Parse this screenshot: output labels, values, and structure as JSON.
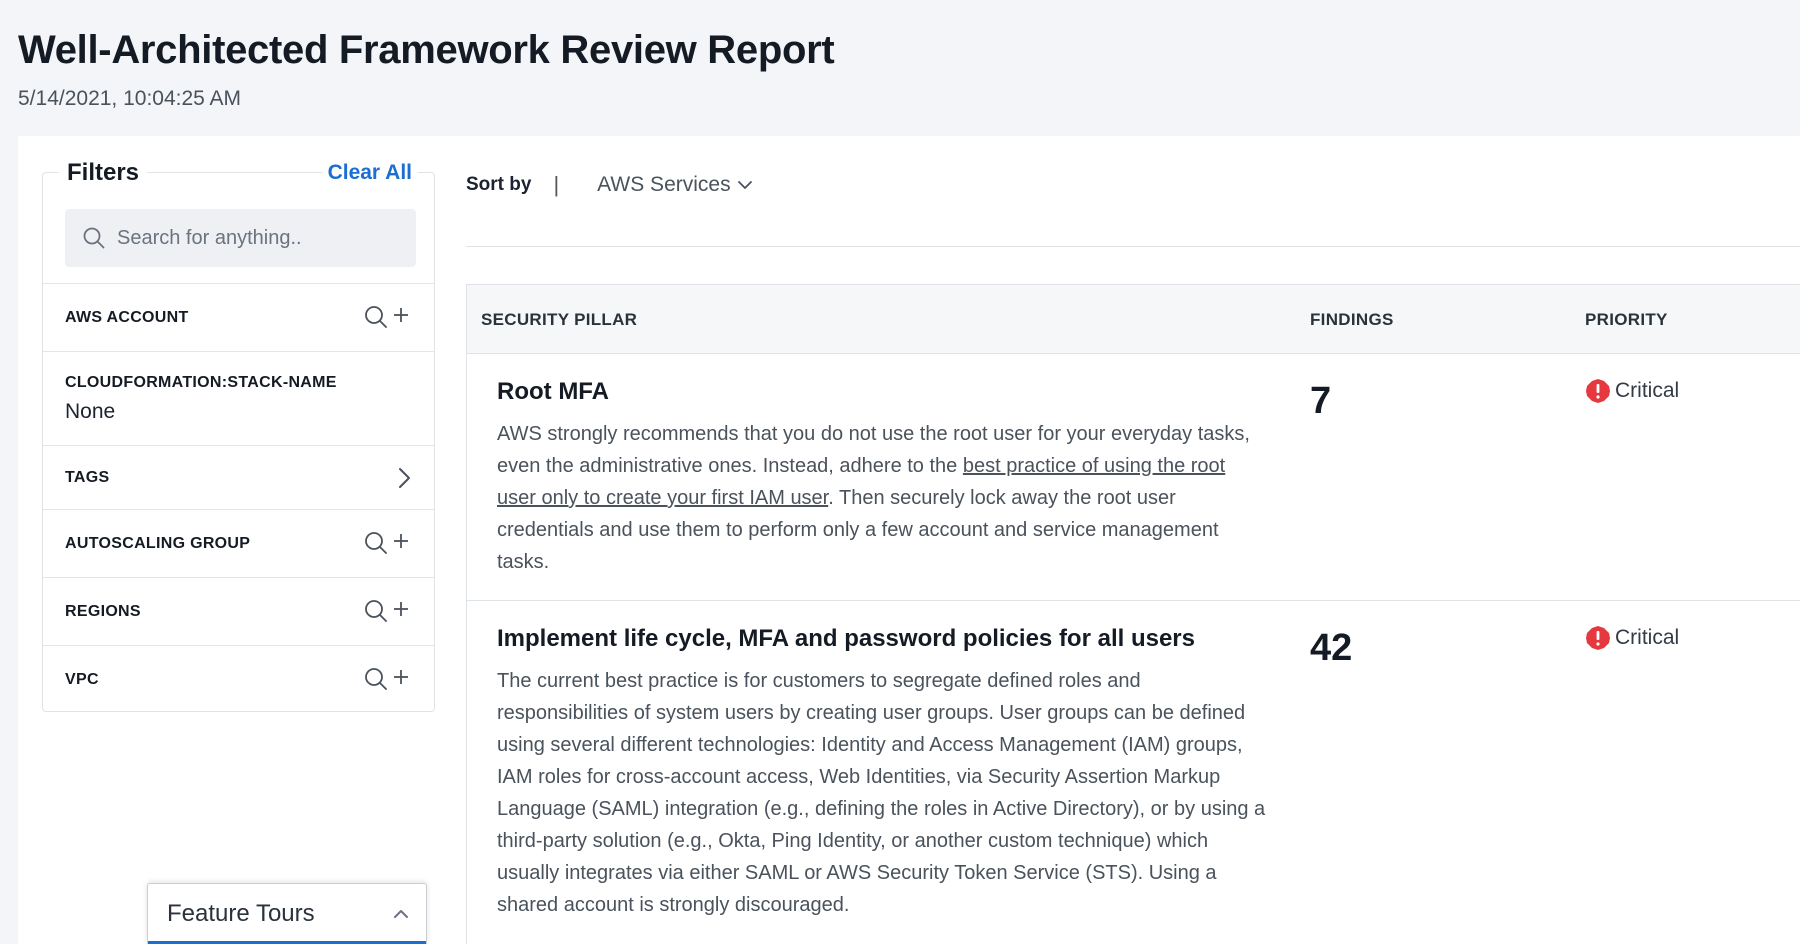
{
  "header": {
    "title": "Well-Architected Framework Review Report",
    "timestamp": "5/14/2021, 10:04:25 AM"
  },
  "filters": {
    "title": "Filters",
    "clear_all": "Clear All",
    "search_placeholder": "Search for anything..",
    "items": [
      {
        "label": "AWS ACCOUNT",
        "action": "search-add-icon"
      },
      {
        "label": "CLOUDFORMATION:STACK-NAME",
        "value": "None"
      },
      {
        "label": "TAGS",
        "action": "chevron-right-icon"
      },
      {
        "label": "AUTOSCALING GROUP",
        "action": "search-add-icon"
      },
      {
        "label": "REGIONS",
        "action": "search-add-icon"
      },
      {
        "label": "VPC",
        "action": "search-add-icon"
      }
    ]
  },
  "sort": {
    "label": "Sort by",
    "separator": "|",
    "selected": "AWS Services"
  },
  "table": {
    "columns": [
      "SECURITY PILLAR",
      "FINDINGS",
      "PRIORITY"
    ],
    "rows": [
      {
        "title": "Root MFA",
        "desc_before": "AWS strongly recommends that you do not use the root user for your everyday tasks, even the administrative ones. Instead, adhere to the ",
        "desc_link": "best practice of using the root user only to create your first IAM user",
        "desc_after": ". Then securely lock away the root user credentials and use them to perform only a few account and service management tasks.",
        "findings": "7",
        "priority": "Critical"
      },
      {
        "title": "Implement life cycle, MFA and password policies for all users",
        "desc": "The current best practice is for customers to segregate defined roles and responsibilities of system users by creating user groups. User groups can be defined using several different technologies: Identity and Access Management (IAM) groups, IAM roles for cross-account access, Web Identities, via Security Assertion Markup Language (SAML) integration (e.g., defining the roles in Active Directory), or by using a third-party solution (e.g., Okta, Ping Identity, or another custom technique) which usually integrates via either SAML or AWS Security Token Service (STS). Using a shared account is strongly discouraged.",
        "findings": "42",
        "priority": "Critical"
      }
    ]
  },
  "feature_tours": {
    "label": "Feature Tours"
  },
  "colors": {
    "accent": "#1a6fd1",
    "critical": "#e5393f",
    "background": "#f3f5f8"
  }
}
